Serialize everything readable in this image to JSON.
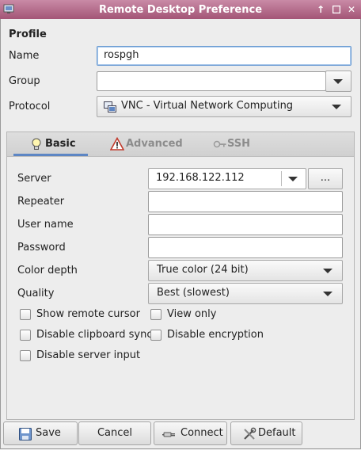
{
  "window": {
    "title": "Remote Desktop Preference"
  },
  "profile": {
    "section_label": "Profile",
    "name_label": "Name",
    "name_value": "rospgh",
    "group_label": "Group",
    "group_value": "",
    "protocol_label": "Protocol",
    "protocol_value": "VNC - Virtual Network Computing"
  },
  "tabs": [
    {
      "label": "Basic",
      "icon": "lightbulb-icon",
      "active": true
    },
    {
      "label": "Advanced",
      "icon": "warning-icon",
      "active": false
    },
    {
      "label": "SSH",
      "icon": "key-icon",
      "active": false
    }
  ],
  "basic": {
    "server_label": "Server",
    "server_value": "192.168.122.112",
    "server_browse": "...",
    "repeater_label": "Repeater",
    "repeater_value": "",
    "username_label": "User name",
    "username_value": "",
    "password_label": "Password",
    "password_value": "",
    "colordepth_label": "Color depth",
    "colordepth_value": "True color (24 bit)",
    "quality_label": "Quality",
    "quality_value": "Best (slowest)",
    "checks": {
      "show_remote_cursor": "Show remote cursor",
      "view_only": "View only",
      "disable_clipboard_sync": "Disable clipboard sync",
      "disable_encryption": "Disable encryption",
      "disable_server_input": "Disable server input"
    }
  },
  "buttons": {
    "save": "Save",
    "cancel": "Cancel",
    "connect": "Connect",
    "default": "Default"
  },
  "colors": {
    "titlebar": "#a35576",
    "tab_accent": "#5d86c4"
  }
}
